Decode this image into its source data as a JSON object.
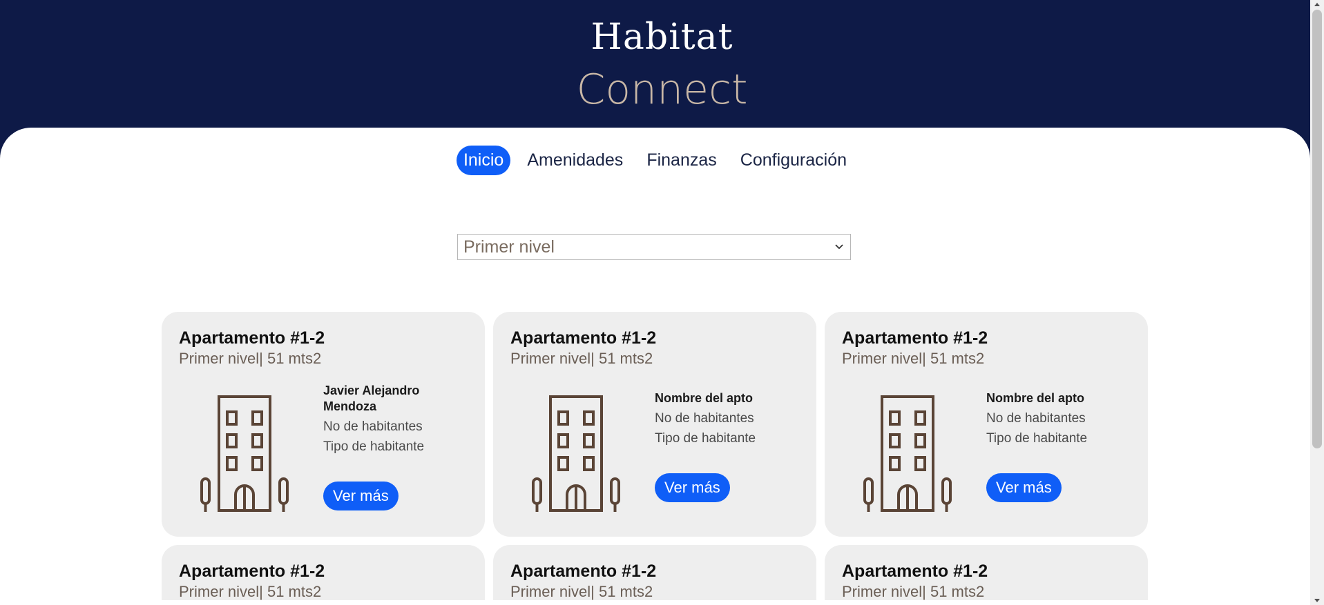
{
  "brand": {
    "line1": "Habitat",
    "line2": "Connect"
  },
  "nav": {
    "items": [
      {
        "label": "Inicio",
        "active": true
      },
      {
        "label": "Amenidades"
      },
      {
        "label": "Finanzas"
      },
      {
        "label": "Configuración"
      }
    ]
  },
  "level_select": {
    "value": "Primer nivel"
  },
  "cards": [
    {
      "title": "Apartamento #1-2",
      "subtitle": "Primer nivel| 51 mts2",
      "name": "Javier Alejandro Mendoza",
      "line1": "No de habitantes",
      "line2": "Tipo de habitante",
      "button": "Ver más"
    },
    {
      "title": "Apartamento #1-2",
      "subtitle": "Primer nivel| 51 mts2",
      "name": "Nombre del apto",
      "line1": "No de habitantes",
      "line2": "Tipo de habitante",
      "button": "Ver más"
    },
    {
      "title": "Apartamento #1-2",
      "subtitle": "Primer nivel| 51 mts2",
      "name": "Nombre del apto",
      "line1": "No de habitantes",
      "line2": "Tipo de habitante",
      "button": "Ver más"
    },
    {
      "title": "Apartamento #1-2",
      "subtitle": "Primer nivel| 51 mts2"
    },
    {
      "title": "Apartamento #1-2",
      "subtitle": "Primer nivel| 51 mts2"
    },
    {
      "title": "Apartamento #1-2",
      "subtitle": "Primer nivel| 51 mts2"
    }
  ],
  "colors": {
    "header_bg": "#0e1a47",
    "accent": "#0f5ef7",
    "brand_secondary": "#c8b7a6",
    "card_bg": "#eeeeee",
    "icon": "#5a4436"
  },
  "icons": {
    "building": "building-icon",
    "select": "chevron-down-icon"
  }
}
